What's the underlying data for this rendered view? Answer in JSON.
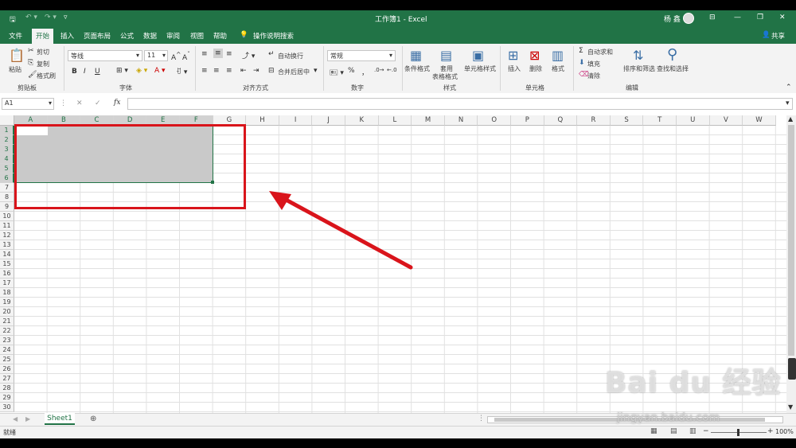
{
  "window": {
    "title": "工作簿1 - Excel",
    "user": "杨 鑫"
  },
  "quick_access": [
    "save-icon",
    "undo-icon",
    "redo-icon",
    "customize-icon"
  ],
  "tabs": [
    {
      "label": "文件"
    },
    {
      "label": "开始",
      "active": true
    },
    {
      "label": "插入"
    },
    {
      "label": "页面布局"
    },
    {
      "label": "公式"
    },
    {
      "label": "数据"
    },
    {
      "label": "审阅"
    },
    {
      "label": "视图"
    },
    {
      "label": "帮助"
    }
  ],
  "tell_me": "操作说明搜索",
  "share": "共享",
  "ribbon": {
    "clipboard": {
      "paste": "粘贴",
      "cut": "剪切",
      "copy": "复制",
      "format_painter": "格式刷",
      "group": "剪贴板"
    },
    "font": {
      "name": "等线",
      "size": "11",
      "group": "字体",
      "bold": "B",
      "italic": "I",
      "underline": "U"
    },
    "alignment": {
      "wrap": "自动换行",
      "merge": "合并后居中",
      "group": "对齐方式"
    },
    "number": {
      "format": "常规",
      "percent": "%",
      "comma": "，",
      "group": "数字"
    },
    "styles": {
      "conditional": "条件格式",
      "table_line1": "套用",
      "table_line2": "表格格式",
      "cell_styles": "单元格样式",
      "group": "样式"
    },
    "cells": {
      "insert": "插入",
      "delete": "删除",
      "format": "格式",
      "group": "单元格"
    },
    "editing": {
      "autosum": "自动求和",
      "fill": "填充",
      "clear": "清除",
      "sort": "排序和筛选",
      "find": "查找和选择",
      "group": "编辑"
    }
  },
  "formula_bar": {
    "name_box": "A1",
    "fx": "fx",
    "value": ""
  },
  "columns": [
    "A",
    "B",
    "C",
    "D",
    "E",
    "F",
    "G",
    "H",
    "I",
    "J",
    "K",
    "L",
    "M",
    "N",
    "O",
    "P",
    "Q",
    "R",
    "S",
    "T",
    "U",
    "V",
    "W"
  ],
  "rows": [
    "1",
    "2",
    "3",
    "4",
    "5",
    "6",
    "7",
    "8",
    "9",
    "10",
    "11",
    "12",
    "13",
    "14",
    "15",
    "16",
    "17",
    "18",
    "19",
    "20",
    "21",
    "22",
    "23",
    "24",
    "25",
    "26",
    "27",
    "28",
    "29",
    "30"
  ],
  "selection": {
    "range": "A1:F6",
    "active_cell": "A1"
  },
  "sheet_tab": "Sheet1",
  "status": {
    "ready": "就绪",
    "zoom": "100%"
  },
  "colors": {
    "excel_green": "#217346",
    "annotation_red": "#d9141b",
    "selection_fill": "#c9c9c9"
  },
  "watermark": {
    "brand": "Bai du 经验",
    "url": "jingyan.baidu.com"
  }
}
